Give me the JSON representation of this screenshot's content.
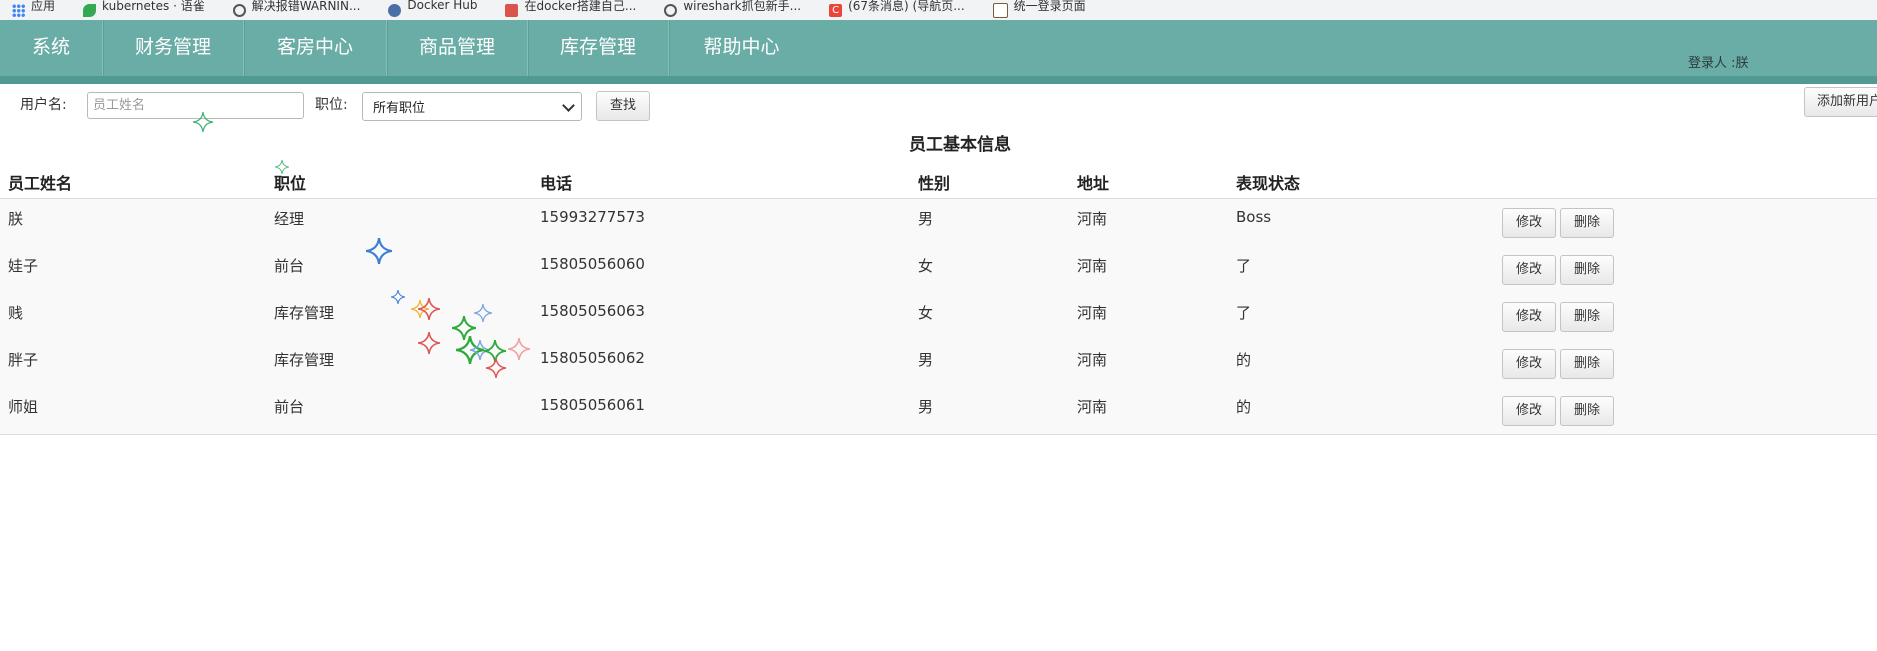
{
  "bookmarks": [
    {
      "label": "应用",
      "icon": "apps-icon"
    },
    {
      "label": "kubernetes · 语雀",
      "icon": "yuque-leaf-icon"
    },
    {
      "label": "解决报错WARNIN...",
      "icon": "wireshark-fin-icon"
    },
    {
      "label": "Docker Hub",
      "icon": "docker-icon"
    },
    {
      "label": "在docker搭建自己...",
      "icon": "bookmark-red-icon"
    },
    {
      "label": "wireshark抓包新手...",
      "icon": "wireshark-fin-icon"
    },
    {
      "label": "(67条消息) (导航页...",
      "icon": "csdn-icon"
    },
    {
      "label": "统一登录页面",
      "icon": "image-icon"
    }
  ],
  "nav": {
    "items": [
      "系统",
      "财务管理",
      "客房中心",
      "商品管理",
      "库存管理",
      "帮助中心"
    ],
    "login_user": "登录人 :朕"
  },
  "filter": {
    "username_label": "用户名:",
    "username_placeholder": "员工姓名",
    "position_label": "职位:",
    "position_selected": "所有职位",
    "search_button": "查找",
    "add_button": "添加新用户"
  },
  "table": {
    "title": "员工基本信息",
    "columns": [
      "员工姓名",
      "职位",
      "电话",
      "性别",
      "地址",
      "表现状态"
    ],
    "edit_label": "修改",
    "delete_label": "删除",
    "rows": [
      [
        "朕",
        "经理",
        "15993277573",
        "男",
        "河南",
        "Boss"
      ],
      [
        "娃子",
        "前台",
        "15805056060",
        "女",
        "河南",
        "了"
      ],
      [
        "贱",
        "库存管理",
        "15805056063",
        "女",
        "河南",
        "了"
      ],
      [
        "胖子",
        "库存管理",
        "15805056062",
        "男",
        "河南",
        "的"
      ],
      [
        "师姐",
        "前台",
        "15805056061",
        "男",
        "河南",
        "的"
      ]
    ]
  },
  "colors": {
    "nav_bg": "#6aaca6",
    "nav_border": "#519a93",
    "row_bg": "#f9f9f9"
  }
}
